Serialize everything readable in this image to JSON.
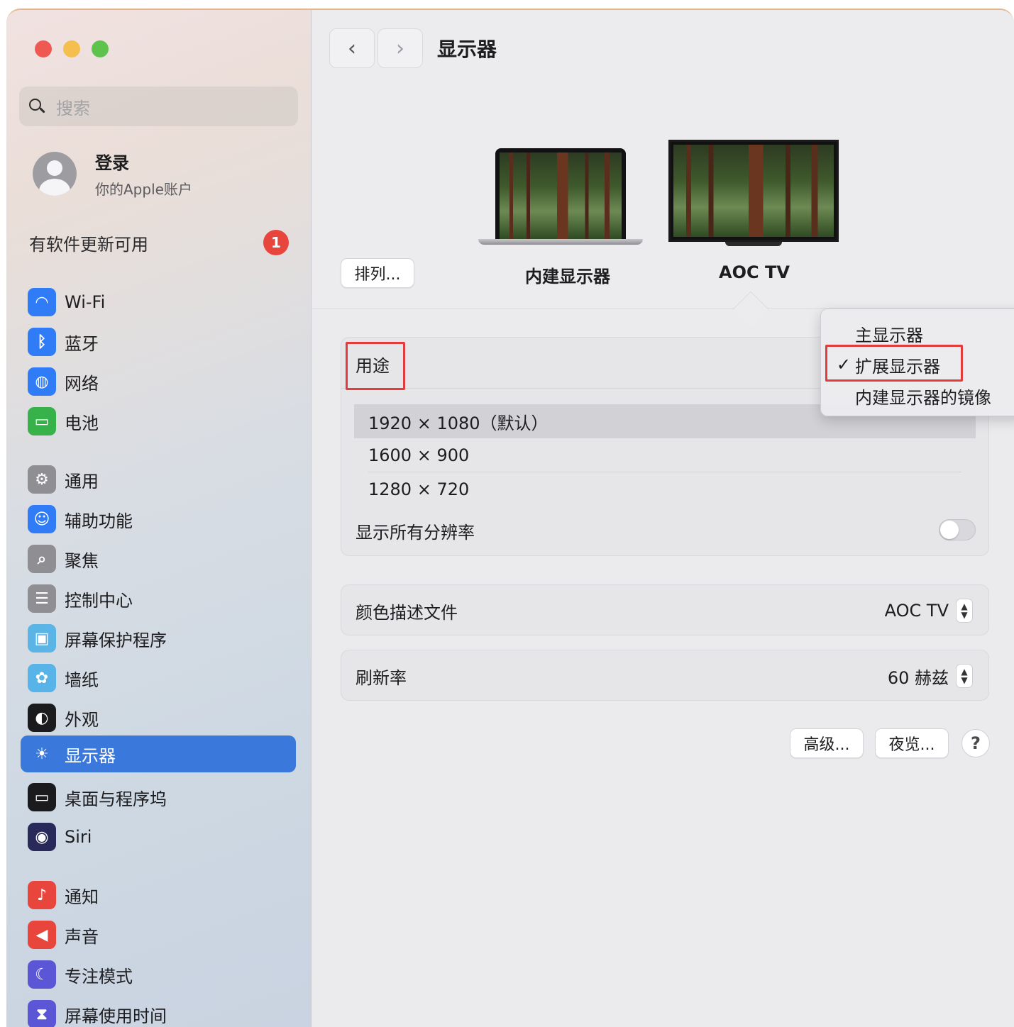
{
  "window": {
    "title": "显示器"
  },
  "search": {
    "placeholder": "搜索"
  },
  "account": {
    "title": "登录",
    "subtitle": "你的Apple账户"
  },
  "update": {
    "label": "有软件更新可用",
    "badge": "1"
  },
  "sidebar": {
    "items": [
      {
        "label": "Wi-Fi",
        "icon": "wifi-icon",
        "color": "#2f7cf6"
      },
      {
        "label": "蓝牙",
        "icon": "bluetooth-icon",
        "color": "#2f7cf6"
      },
      {
        "label": "网络",
        "icon": "globe-icon",
        "color": "#2f7cf6"
      },
      {
        "label": "电池",
        "icon": "battery-icon",
        "color": "#37b24a"
      },
      {
        "label": "通用",
        "icon": "gear-icon",
        "color": "#8e8e93"
      },
      {
        "label": "辅助功能",
        "icon": "accessibility-icon",
        "color": "#2f7cf6"
      },
      {
        "label": "聚焦",
        "icon": "spotlight-icon",
        "color": "#8e8e93"
      },
      {
        "label": "控制中心",
        "icon": "control-center-icon",
        "color": "#8e8e93"
      },
      {
        "label": "屏幕保护程序",
        "icon": "screensaver-icon",
        "color": "#5ab4e6"
      },
      {
        "label": "墙纸",
        "icon": "wallpaper-icon",
        "color": "#58b3e8"
      },
      {
        "label": "外观",
        "icon": "appearance-icon",
        "color": "#1b1b1d"
      },
      {
        "label": "显示器",
        "icon": "display-sun-icon",
        "color": "#3b78dc",
        "selected": true
      },
      {
        "label": "桌面与程序坞",
        "icon": "dock-icon",
        "color": "#1b1b1d"
      },
      {
        "label": "Siri",
        "icon": "siri-icon",
        "color": "#2a2a5a"
      },
      {
        "label": "通知",
        "icon": "notification-bell-icon",
        "color": "#e8453c"
      },
      {
        "label": "声音",
        "icon": "speaker-icon",
        "color": "#e8453c"
      },
      {
        "label": "专注模式",
        "icon": "moon-icon",
        "color": "#5a56d6"
      },
      {
        "label": "屏幕使用时间",
        "icon": "hourglass-icon",
        "color": "#5a56d6"
      }
    ]
  },
  "toolbar": {
    "back": "‹",
    "forward": "›"
  },
  "arrange": {
    "label": "排列..."
  },
  "displays": {
    "builtin": "内建显示器",
    "tv": "AOC TV"
  },
  "use": {
    "label": "用途"
  },
  "resolutions": {
    "items": [
      "1920 × 1080（默认）",
      "1600 × 900",
      "1280 × 720"
    ],
    "selected_index": 0,
    "show_all_label": "显示所有分辨率",
    "show_all_on": false
  },
  "color_profile": {
    "label": "颜色描述文件",
    "value": "AOC TV"
  },
  "refresh": {
    "label": "刷新率",
    "value": "60 赫兹"
  },
  "footer": {
    "advanced": "高级...",
    "night_shift": "夜览...",
    "help": "?"
  },
  "use_menu": {
    "items": [
      "主显示器",
      "扩展显示器",
      "内建显示器的镜像"
    ],
    "checked_index": 1,
    "check_mark": "✓"
  },
  "colors": {
    "accent": "#3b78dc",
    "highlight": "#e33b3b",
    "badge": "#e8463c"
  }
}
